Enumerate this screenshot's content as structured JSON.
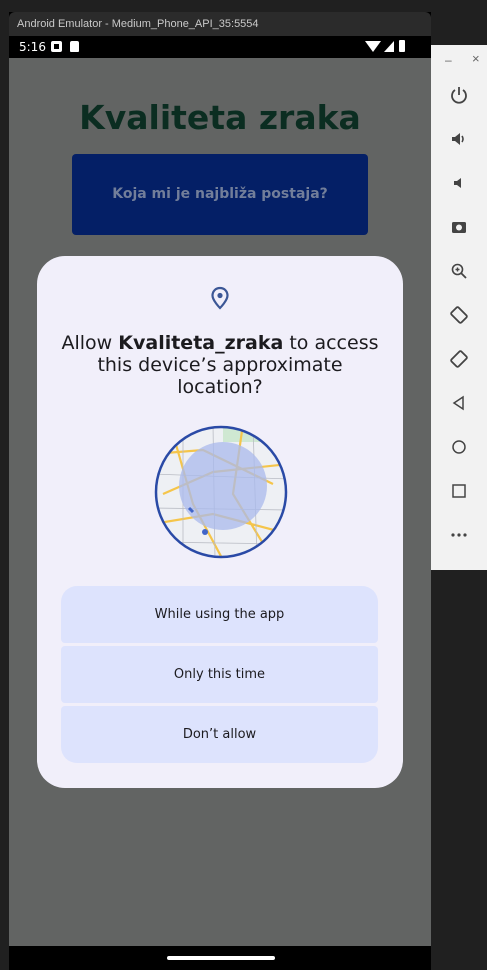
{
  "window": {
    "title": "Android Emulator - Medium_Phone_API_35:5554"
  },
  "status_bar": {
    "time": "5:16"
  },
  "app": {
    "title": "Kvaliteta zraka",
    "nearest_station_button": "Koja mi je najbliža postaja?"
  },
  "dialog": {
    "title_prefix": "Allow ",
    "app_name": "Kvaliteta_zraka",
    "title_suffix": " to access this device’s approximate location?",
    "buttons": {
      "while_using": "While using the app",
      "only_this_time": "Only this time",
      "dont_allow": "Don’t allow"
    }
  },
  "toolbar": {
    "minimize": "–",
    "close": "×",
    "icons": [
      "power-icon",
      "volume-up-icon",
      "volume-down-icon",
      "camera-icon",
      "zoom-icon",
      "rotate-left-icon",
      "rotate-right-icon",
      "back-icon",
      "home-icon",
      "overview-icon",
      "more-icon"
    ]
  }
}
